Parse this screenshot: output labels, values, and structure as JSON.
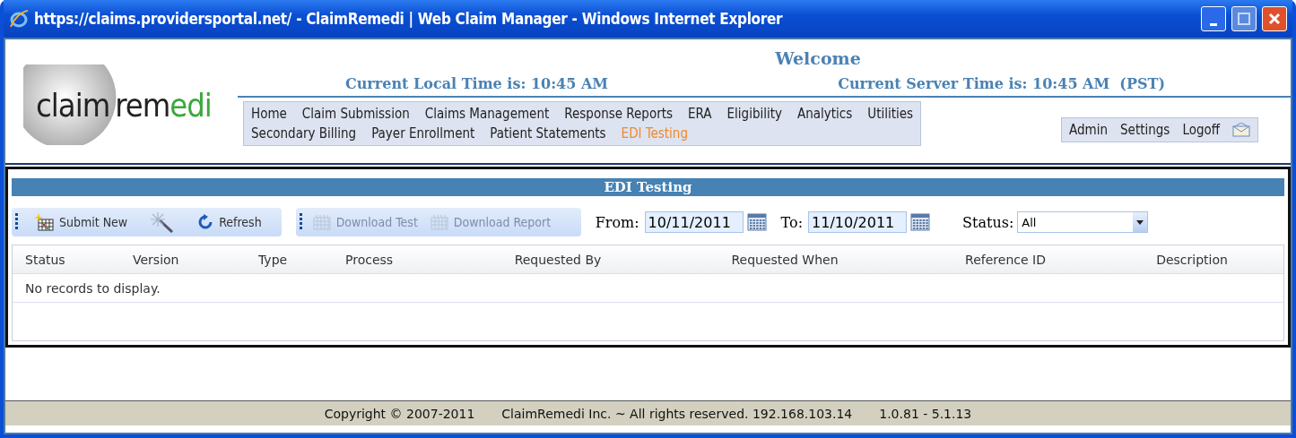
{
  "window": {
    "title": "https://claims.providersportal.net/ - ClaimRemedi | Web Claim Manager - Windows Internet Explorer"
  },
  "logo": {
    "part_1": "claim",
    "part_2": "rem",
    "part_3": "edi"
  },
  "header": {
    "welcome": "Welcome",
    "local_time": "Current Local Time is: 10:45 AM",
    "server_time": "Current Server Time is: 10:45 AM  (PST)"
  },
  "nav": [
    [
      {
        "label": "Home",
        "selected": false
      },
      {
        "label": "Claim Submission",
        "selected": false
      },
      {
        "label": "Claims Management",
        "selected": false
      },
      {
        "label": "Response Reports",
        "selected": false
      },
      {
        "label": "ERA",
        "selected": false
      },
      {
        "label": "Eligibility",
        "selected": false
      },
      {
        "label": "Analytics",
        "selected": false
      },
      {
        "label": "Utilities",
        "selected": false
      }
    ],
    [
      {
        "label": "Secondary Billing",
        "selected": false
      },
      {
        "label": "Payer Enrollment",
        "selected": false
      },
      {
        "label": "Patient Statements",
        "selected": false
      },
      {
        "label": "EDI Testing",
        "selected": true
      }
    ]
  ],
  "user_menu": [
    "Admin",
    "Settings",
    "Logoff"
  ],
  "panel": {
    "title": "EDI Testing",
    "toolbar_1": [
      {
        "label": "Submit New",
        "kind": "submit"
      },
      {
        "kind": "wand"
      },
      {
        "label": "Refresh",
        "kind": "refresh"
      }
    ],
    "toolbar_2": [
      {
        "label": "Download Test",
        "disabled": true
      },
      {
        "label": "Download Report",
        "disabled": true
      }
    ],
    "from": {
      "label": "From:",
      "value": "10/11/2011"
    },
    "to": {
      "label": "To:",
      "value": "11/10/2011"
    },
    "status": {
      "label": "Status:",
      "value": "All"
    },
    "table": {
      "columns": [
        "Status",
        "Version",
        "Type",
        "Process",
        "Requested By",
        "Requested When",
        "Reference ID",
        "Description"
      ],
      "empty_message": "No records to display."
    }
  },
  "footer": {
    "copyright": "Copyright © 2007-2011",
    "rights": "ClaimRemedi Inc. ~ All rights reserved. 192.168.103.14",
    "version": "1.0.81 - 5.1.13"
  }
}
